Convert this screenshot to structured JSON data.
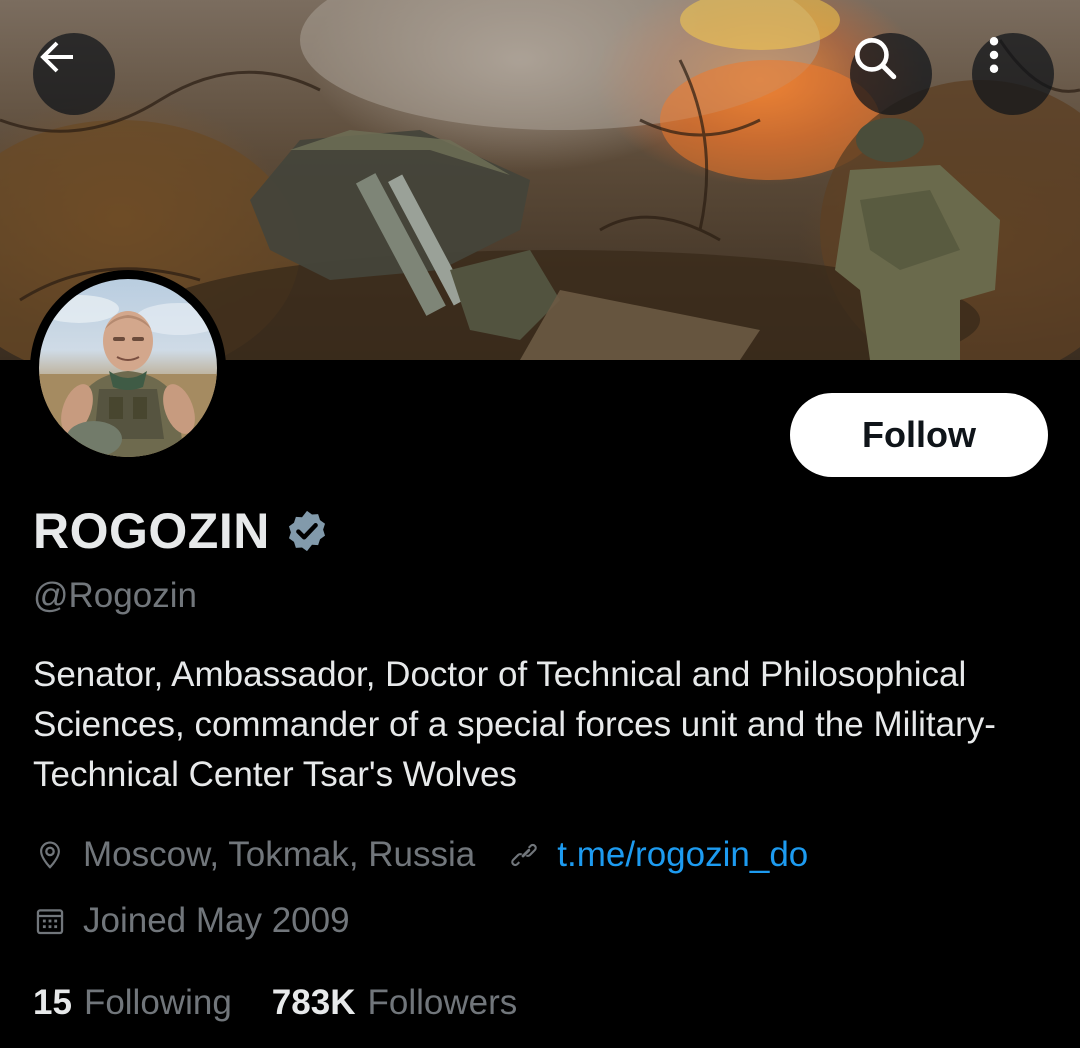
{
  "profile": {
    "display_name": "ROGOZIN",
    "handle": "@Rogozin",
    "bio": "Senator, Ambassador, Doctor of Technical and Philosophical Sciences, commander of a special forces unit and the Military-Technical Center Tsar's Wolves",
    "location": "Moscow, Tokmak, Russia",
    "website": "t.me/rogozin_do",
    "joined": "Joined May 2009",
    "verified": true
  },
  "actions": {
    "follow_label": "Follow"
  },
  "stats": {
    "following_count": "15",
    "following_label": "Following",
    "followers_count": "783K",
    "followers_label": "Followers"
  },
  "icons": {
    "back": "back-arrow-icon",
    "search": "search-icon",
    "more": "more-vertical-icon",
    "verified": "verified-badge-icon",
    "location": "location-pin-icon",
    "link": "link-icon",
    "calendar": "calendar-icon"
  },
  "colors": {
    "background": "#000000",
    "text_primary": "#e7e9ea",
    "text_secondary": "#71767b",
    "link": "#1d9bf0",
    "verified_badge": "#829aab",
    "follow_button_bg": "#ffffff"
  }
}
